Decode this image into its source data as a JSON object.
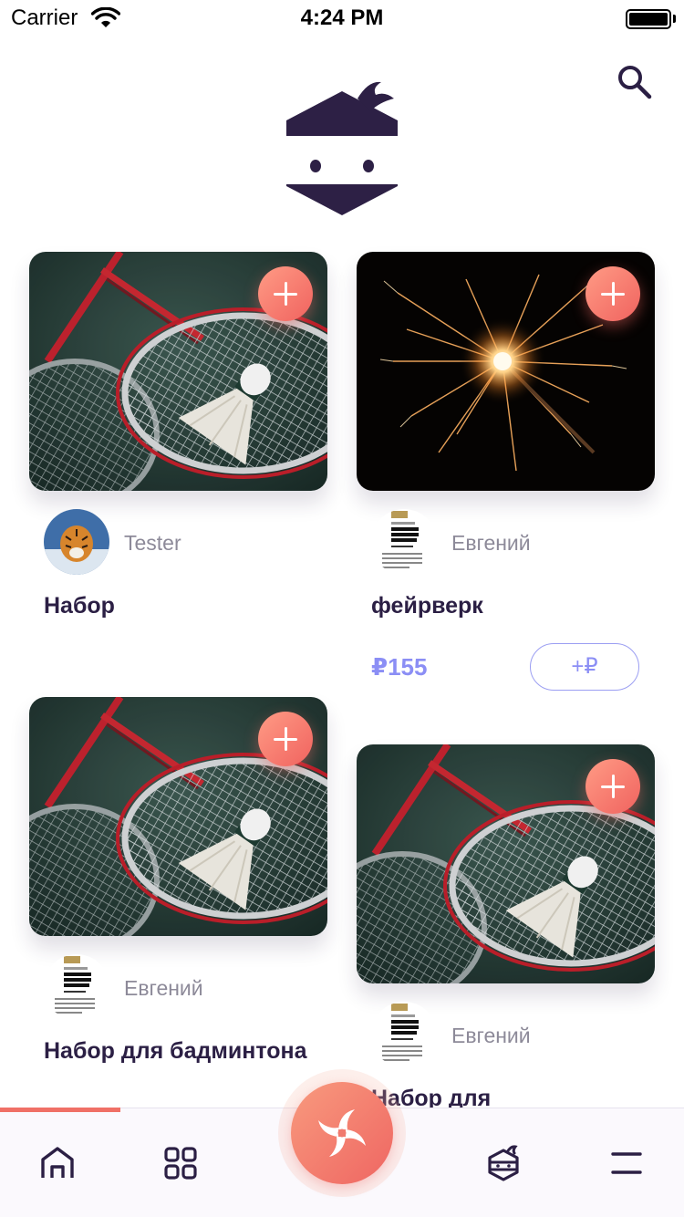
{
  "status_bar": {
    "carrier": "Carrier",
    "time": "4:24 PM"
  },
  "header": {
    "search_icon": "search-icon",
    "logo_icon": "ninja-logo"
  },
  "feed": {
    "cards": [
      {
        "title": "Набор",
        "author": "Tester",
        "avatar": "tiger-photo",
        "image": "badminton-photo",
        "add_icon": "plus-icon"
      },
      {
        "title": "фейрверк",
        "author": "Евгений",
        "avatar": "document-thumbnail",
        "image": "sparkler-photo",
        "price": "₽155",
        "tip_label": "+₽",
        "add_icon": "plus-icon"
      },
      {
        "title": "Набор для бадминтона",
        "author": "Евгений",
        "avatar": "document-thumbnail",
        "image": "badminton-photo",
        "add_icon": "plus-icon"
      },
      {
        "title": "Набор для",
        "author": "Евгений",
        "avatar": "document-thumbnail",
        "image": "badminton-photo",
        "add_icon": "plus-icon"
      }
    ]
  },
  "tabbar": {
    "items": [
      {
        "icon": "home-icon"
      },
      {
        "icon": "grid-icon"
      },
      {
        "icon": "shuriken-icon"
      },
      {
        "icon": "ninja-head-icon"
      },
      {
        "icon": "menu-icon"
      }
    ],
    "active_index": 0
  },
  "colors": {
    "accent": "#f07066",
    "price": "#8b8ef5",
    "text": "#2b1f44",
    "muted": "#8d8a99"
  }
}
